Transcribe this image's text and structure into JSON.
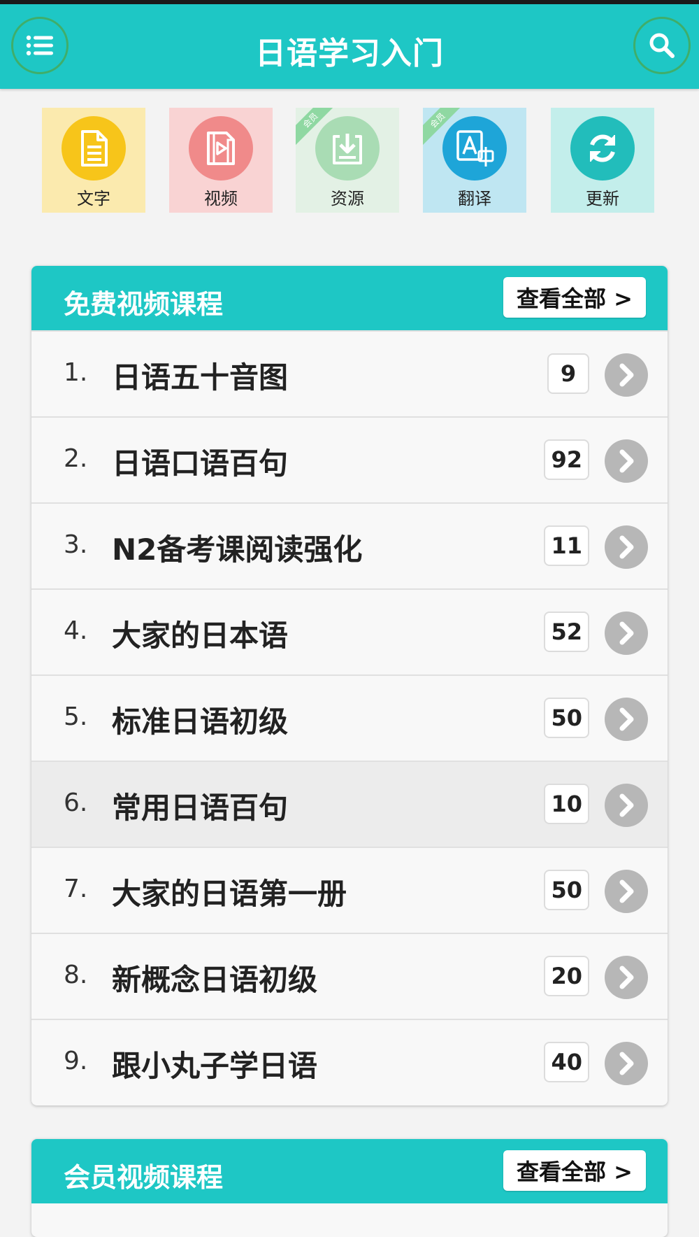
{
  "header": {
    "title": "日语学习入门",
    "menu_icon": "list-menu-icon",
    "search_icon": "search-icon"
  },
  "quick_menu": [
    {
      "label": "文字",
      "icon": "document-icon",
      "bg": "#fbeaae",
      "circle": "#f7c51a",
      "member": false,
      "ribbon": ""
    },
    {
      "label": "视频",
      "icon": "video-icon",
      "bg": "#f9d3d3",
      "circle": "#f08a8a",
      "member": false,
      "ribbon": ""
    },
    {
      "label": "资源",
      "icon": "download-icon",
      "bg": "#e3f1e5",
      "circle": "#a9dcb4",
      "member": true,
      "ribbon": "会员"
    },
    {
      "label": "翻译",
      "icon": "translate-icon",
      "bg": "#bfe6f2",
      "circle": "#1ea5d8",
      "member": true,
      "ribbon": "会员"
    },
    {
      "label": "更新",
      "icon": "refresh-icon",
      "bg": "#c3eeeb",
      "circle": "#22bdbb",
      "member": false,
      "ribbon": ""
    }
  ],
  "free_courses": {
    "title": "免费视频课程",
    "view_all": "查看全部 >",
    "items": [
      {
        "num": "1.",
        "title": "日语五十音图",
        "count": "9"
      },
      {
        "num": "2.",
        "title": "日语口语百句",
        "count": "92"
      },
      {
        "num": "3.",
        "title": "N2备考课阅读强化",
        "count": "11"
      },
      {
        "num": "4.",
        "title": "大家的日本语",
        "count": "52"
      },
      {
        "num": "5.",
        "title": "标准日语初级",
        "count": "50"
      },
      {
        "num": "6.",
        "title": "常用日语百句",
        "count": "10"
      },
      {
        "num": "7.",
        "title": "大家的日语第一册",
        "count": "50"
      },
      {
        "num": "8.",
        "title": "新概念日语初级",
        "count": "20"
      },
      {
        "num": "9.",
        "title": "跟小丸子学日语",
        "count": "40"
      }
    ]
  },
  "member_courses": {
    "title": "会员视频课程",
    "view_all": "查看全部 >"
  },
  "colors": {
    "accent": "#1ec7c5",
    "background": "#f3f3f3",
    "chevron": "#b7b7b7"
  }
}
